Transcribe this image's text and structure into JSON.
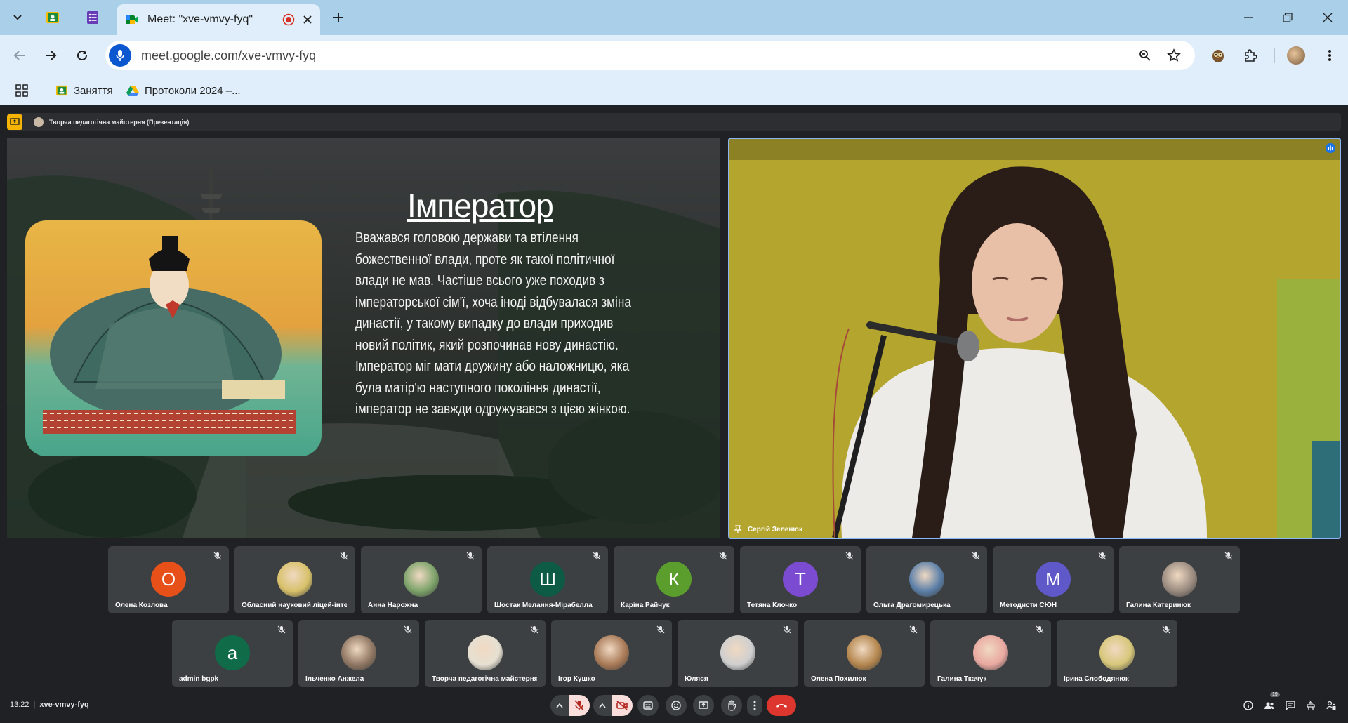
{
  "browser": {
    "tab_title": "Meet: \"xve-vmvy-fyq\"",
    "url": "meet.google.com/xve-vmvy-fyq",
    "bookmarks": [
      {
        "label": "Заняття",
        "icon": "classroom-icon"
      },
      {
        "label": "Протоколи 2024 –...",
        "icon": "drive-icon"
      }
    ]
  },
  "meet": {
    "presentation_label": "Творча педагогічна майстерня (Презентація)",
    "slide": {
      "title": "Імператор",
      "body": "Вважався головою держави та втілення божественної влади, проте як такої політичної влади не мав. Частіше всього уже походив з імператорської сім'ї, хоча іноді відбувалася зміна династії, у такому випадку до влади приходив новий політик, який розпочинав нову династію. Імператор міг мати дружину або наложницю, яка була матір'ю наступного покоління династії, імператор не завжди одружувався з цією жінкою."
    },
    "speaker_name": "Сергій Зеленюк",
    "participants_row1": [
      {
        "name": "Олена Козлова",
        "initial": "О",
        "color": "#e8501a"
      },
      {
        "name": "Обласний науковий ліцей-інтер...",
        "initial": "",
        "color": "#d8c16a"
      },
      {
        "name": "Анна Нарожна",
        "initial": "",
        "color": "#7da36a"
      },
      {
        "name": "Шостак Мелання-Мірабелла",
        "initial": "Ш",
        "color": "#0d5b45"
      },
      {
        "name": "Каріна Райчук",
        "initial": "К",
        "color": "#5c9e2e"
      },
      {
        "name": "Тетяна Клочко",
        "initial": "Т",
        "color": "#7b4bd1"
      },
      {
        "name": "Ольга Драгомирецька",
        "initial": "",
        "color": "#5b7fa8"
      },
      {
        "name": "Методисти СЮН",
        "initial": "М",
        "color": "#5f58c9"
      },
      {
        "name": "Галина Катеринюк",
        "initial": "",
        "color": "#9a8b80"
      }
    ],
    "participants_row2": [
      {
        "name": "admin bgpk",
        "initial": "a",
        "color": "#0f6b48"
      },
      {
        "name": "Ільченко Анжела",
        "initial": "",
        "color": "#8f7763"
      },
      {
        "name": "Творча педагогічна майстерня",
        "initial": "",
        "color": "#e6e0d2"
      },
      {
        "name": "Ігор Кушко",
        "initial": "",
        "color": "#a97a57"
      },
      {
        "name": "Юляся",
        "initial": "",
        "color": "#cfcfcf"
      },
      {
        "name": "Олена Похилюк",
        "initial": "",
        "color": "#b5874f"
      },
      {
        "name": "Галина Ткачук",
        "initial": "",
        "color": "#e9a8a0"
      },
      {
        "name": "Ірина Слободянюк",
        "initial": "",
        "color": "#d7c77a"
      }
    ],
    "time": "13:22",
    "meeting_code": "xve-vmvy-fyq",
    "participant_count": "19"
  }
}
